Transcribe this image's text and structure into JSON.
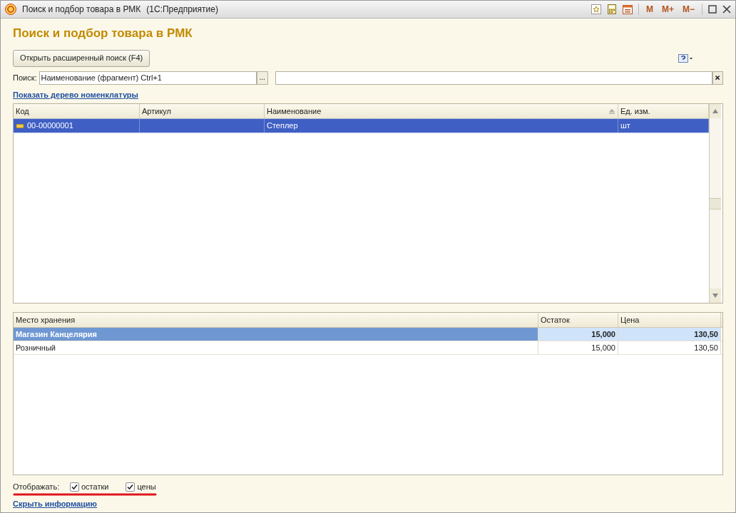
{
  "window": {
    "title": "Поиск и подбор товара в РМК",
    "subtitle": "(1С:Предприятие)",
    "memory_buttons": [
      "M",
      "M+",
      "M−"
    ]
  },
  "heading": "Поиск и подбор товара в РМК",
  "advanced_search_button": "Открыть расширенный поиск (F4)",
  "search": {
    "label": "Поиск:",
    "mode_value": "Наименование (фрагмент) Ctrl+1",
    "select_button": "..."
  },
  "show_tree_link": "Показать дерево номенклатуры",
  "items_table": {
    "columns": [
      {
        "label": "Код",
        "sorted": false
      },
      {
        "label": "Артикул",
        "sorted": false
      },
      {
        "label": "Наименование",
        "sorted": true
      },
      {
        "label": "Ед. изм.",
        "sorted": false
      }
    ],
    "rows": [
      {
        "cells": [
          "00-00000001",
          "",
          "Степлер",
          "шт"
        ],
        "selected": true
      }
    ]
  },
  "stock_table": {
    "columns": [
      "Место хранения",
      "Остаток",
      "Цена"
    ],
    "rows": [
      {
        "kind": "group",
        "cells": [
          "Магазин Канцелярия",
          "15,000",
          "130,50"
        ],
        "selected": true
      },
      {
        "kind": "item",
        "cells": [
          "Розничный",
          "15,000",
          "130,50"
        ],
        "selected": false
      }
    ]
  },
  "display": {
    "label": "Отображать:",
    "options": [
      {
        "label": "остатки",
        "checked": true
      },
      {
        "label": "цены",
        "checked": true
      }
    ]
  },
  "hide_info_link": "Скрыть информацию"
}
